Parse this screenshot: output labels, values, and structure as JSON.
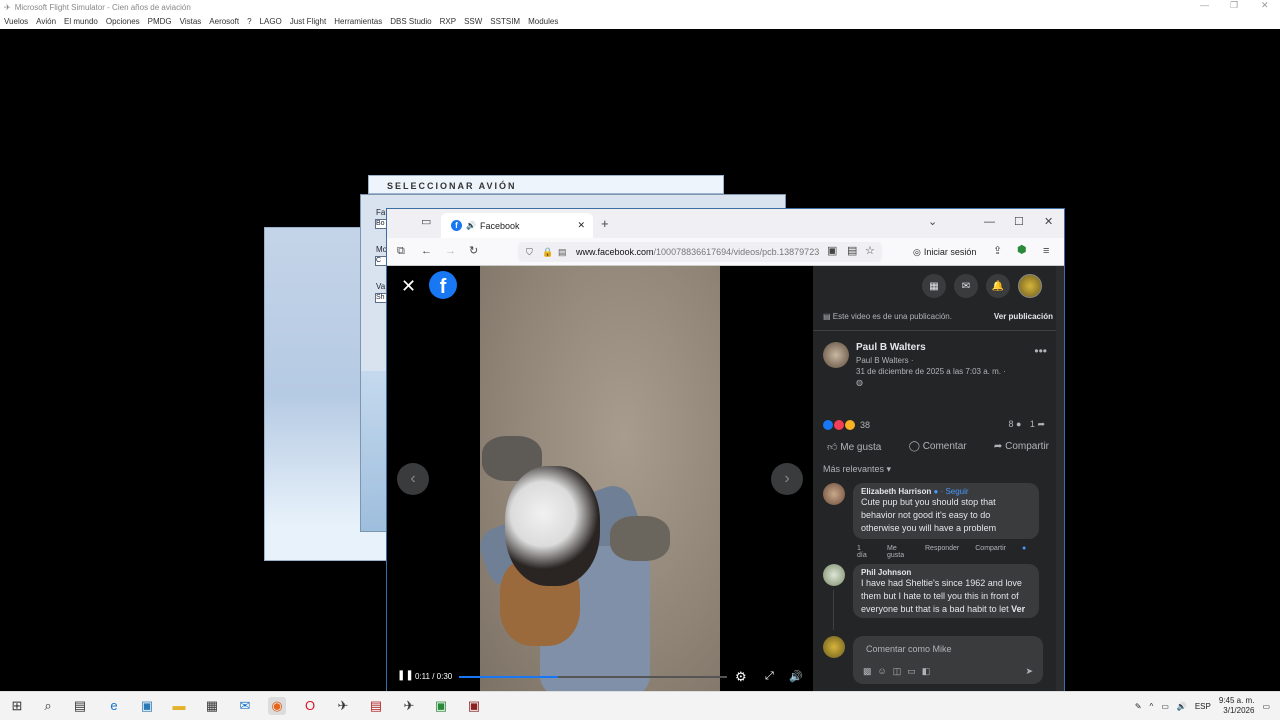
{
  "app": {
    "title": "Microsoft Flight Simulator - Cien años de aviación",
    "menu": [
      "Vuelos",
      "Avión",
      "El mundo",
      "Opciones",
      "PMDG",
      "Vistas",
      "Aerosoft",
      "?",
      "LAGO",
      "Just Flight",
      "Herramientas",
      "DBS Studio",
      "RXP",
      "SSW",
      "SSTSIM",
      "Modules"
    ]
  },
  "fs_dialog": {
    "title": "SELECCIONAR AVIÓN",
    "labels": [
      "Fa",
      "Mo",
      "Va"
    ],
    "fields": [
      "Bo",
      "C",
      "Sh"
    ]
  },
  "browser": {
    "tab_title": "Facebook",
    "new_tab": "+",
    "url_prefix": "www.facebook.com",
    "url_rest": "/100078836617694/videos/pcb.13879723",
    "login_label": "Iniciar sesión"
  },
  "video": {
    "time": "0:11 / 0:30",
    "progress_fraction": 0.37
  },
  "panel": {
    "notice": "Este video es de una publicación.",
    "notice_link": "Ver publicación",
    "author": {
      "name": "Paul B Walters",
      "sub": "Paul B Walters ·",
      "date": "31 de diciembre de 2025 a las 7:03 a. m. ·"
    },
    "reactions_count": "38",
    "comments_count": "8",
    "shares_count": "1",
    "actions": [
      "Me gusta",
      "Comentar",
      "Compartir"
    ],
    "sort_label": "Más relevantes",
    "comments": [
      {
        "name": "Elizabeth Harrison",
        "follow": "· Seguir",
        "text": "Cute pup but you should stop that behavior not good it's easy to do otherwise you will have a problem",
        "time": "1 día",
        "like": "Me gusta",
        "reply": "Responder",
        "share": "Compartir"
      },
      {
        "name": "Phil Johnson",
        "text": "I have had Sheltie's since 1962 and love them but I hate to tell you this in front of everyone but that is a bad habit to let",
        "more": "Ver más"
      }
    ],
    "compose_placeholder": "Comentar como Mike"
  },
  "taskbar": {
    "lang": "ESP",
    "time": "9:45 a. m.",
    "date": "3/1/2026"
  }
}
